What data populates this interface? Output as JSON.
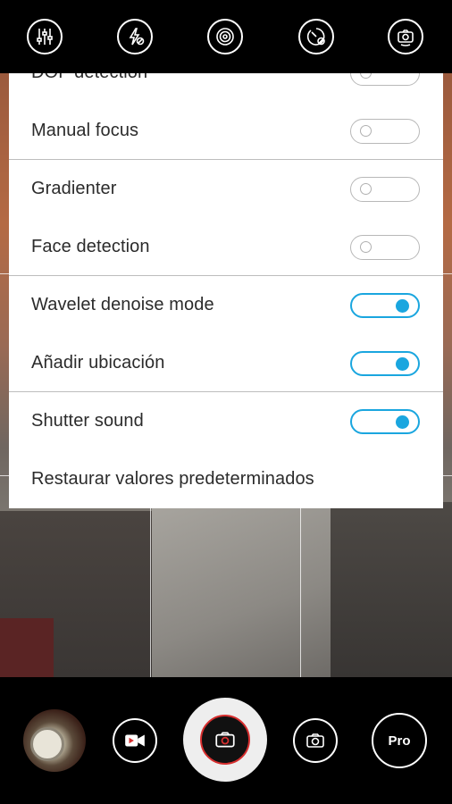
{
  "top_bar": {
    "icons": [
      "sliders-icon",
      "flash-auto-icon",
      "hdr-lens-icon",
      "timer-off-icon",
      "camera-switch-icon"
    ]
  },
  "settings": {
    "rows": [
      {
        "label": "DOF detection",
        "enabled": false
      },
      {
        "label": "Manual focus",
        "enabled": false
      },
      {
        "label": "Gradienter",
        "enabled": false
      },
      {
        "label": "Face detection",
        "enabled": false
      },
      {
        "label": "Wavelet denoise mode",
        "enabled": true
      },
      {
        "label": "Añadir ubicación",
        "enabled": true
      },
      {
        "label": "Shutter sound",
        "enabled": true
      }
    ],
    "restore_label": "Restaurar valores predeterminados"
  },
  "bottom_bar": {
    "pro_label": "Pro"
  },
  "colors": {
    "accent": "#1aa6df",
    "shutter_ring": "#d62e2e"
  }
}
